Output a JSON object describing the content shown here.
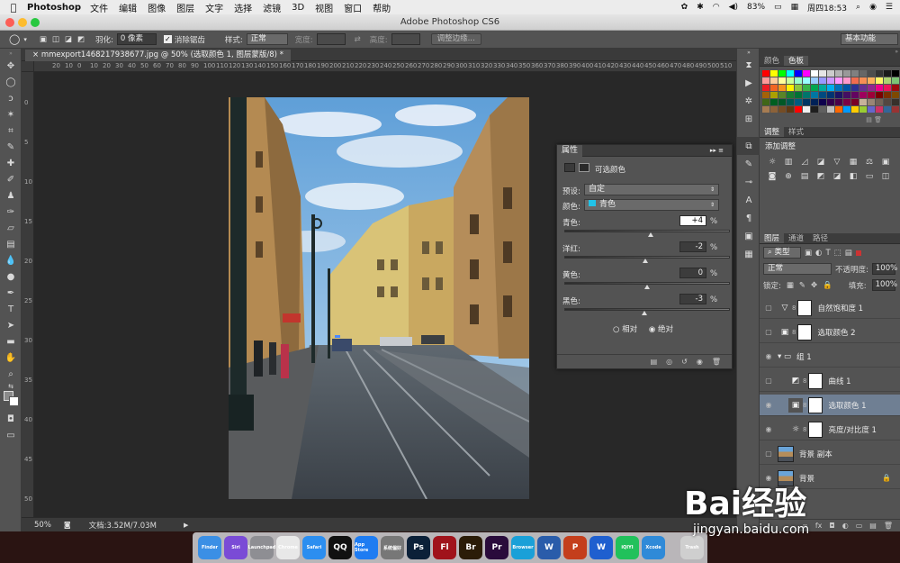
{
  "menubar": {
    "app": "Photoshop",
    "items": [
      "文件",
      "编辑",
      "图像",
      "图层",
      "文字",
      "选择",
      "滤镜",
      "3D",
      "视图",
      "窗口",
      "帮助"
    ],
    "battery": "83%",
    "clock": "周四18:53"
  },
  "window": {
    "title": "Adobe Photoshop CS6"
  },
  "options": {
    "feather_label": "羽化:",
    "feather_value": "0 像素",
    "antialias_label": "消除锯齿",
    "style_label": "样式:",
    "style_value": "正常",
    "width_label": "宽度:",
    "height_label": "高度:",
    "refine_button": "调整边缘...",
    "workspace": "基本功能"
  },
  "document": {
    "tab": "mmexport1468217938677.jpg @ 50% (选取颜色 1, 图层蒙版/8) *",
    "ruler_h": [
      "20",
      "10",
      "0",
      "10",
      "20",
      "30",
      "40",
      "50",
      "60",
      "70",
      "80",
      "90",
      "100",
      "110",
      "120",
      "130",
      "140",
      "150",
      "160",
      "170",
      "180",
      "190",
      "200",
      "210",
      "220",
      "230",
      "240",
      "250",
      "260",
      "270",
      "280",
      "290",
      "300",
      "310",
      "320",
      "330",
      "340",
      "350",
      "360",
      "370",
      "380",
      "390",
      "400",
      "410",
      "420",
      "430",
      "440",
      "450",
      "460",
      "470",
      "480",
      "490",
      "500",
      "510",
      "520",
      "530",
      "540",
      "550"
    ],
    "ruler_v": [
      "0",
      "5",
      "10",
      "15",
      "20",
      "25",
      "30",
      "35",
      "40",
      "45",
      "50"
    ],
    "zoom": "50%",
    "doc_size": "文档:3.52M/7.03M"
  },
  "properties": {
    "panel_title": "属性",
    "subtitle": "可选颜色",
    "preset_label": "预设:",
    "preset_value": "自定",
    "color_label": "颜色:",
    "color_value": "青色",
    "sliders": [
      {
        "label": "青色:",
        "value": "+4",
        "fraction": 0.52
      },
      {
        "label": "洋红:",
        "value": "-2",
        "fraction": 0.49
      },
      {
        "label": "黄色:",
        "value": "0",
        "fraction": 0.5
      },
      {
        "label": "黑色:",
        "value": "-3",
        "fraction": 0.485
      }
    ],
    "pct": "%",
    "relative": "相对",
    "absolute": "绝对"
  },
  "swatches": {
    "tabs": [
      "颜色",
      "色板"
    ],
    "colors": [
      "#ff0000",
      "#ffff00",
      "#00ff00",
      "#00ffff",
      "#0000ff",
      "#ff00ff",
      "#ffffff",
      "#e6e6e6",
      "#cccccc",
      "#b3b3b3",
      "#999999",
      "#808080",
      "#666666",
      "#4d4d4d",
      "#333333",
      "#1a1a1a",
      "#000000",
      "#ff4d4d",
      "#ff9999",
      "#ffcc99",
      "#ffff99",
      "#ccff99",
      "#99ffcc",
      "#99ffff",
      "#99ccff",
      "#9999ff",
      "#cc99ff",
      "#ff99ff",
      "#ff99cc",
      "#f26c4f",
      "#f68e55",
      "#fbaf5d",
      "#fff467",
      "#acd372",
      "#7cc576",
      "#3bb878",
      "#ed1c24",
      "#f26522",
      "#f7941d",
      "#fff200",
      "#8dc63f",
      "#39b54a",
      "#00a651",
      "#00a99d",
      "#00aeef",
      "#0072bc",
      "#0054a6",
      "#2e3192",
      "#662d91",
      "#92278f",
      "#ec008c",
      "#ed145b",
      "#9e0b0f",
      "#a0410d",
      "#a36209",
      "#aba000",
      "#598527",
      "#197b30",
      "#007236",
      "#00746b",
      "#0076a3",
      "#004a80",
      "#003471",
      "#1b1464",
      "#440e62",
      "#630460",
      "#9e005d",
      "#9e0039",
      "#790000",
      "#7b2e00",
      "#7d4900",
      "#827b00",
      "#406618",
      "#005e20",
      "#005826",
      "#005952",
      "#005b7f",
      "#003663",
      "#002157",
      "#0d004c",
      "#32004b",
      "#4b0049",
      "#7b0046",
      "#7a0026",
      "#c7b299",
      "#998675",
      "#736357",
      "#534741",
      "#37302a",
      "#c69c6d",
      "#a67c52",
      "#8c6239",
      "#754c24",
      "#603913",
      "#ff0000",
      "#f0f0f0",
      "#1e1e1e",
      "#606060",
      "#c0c0c0",
      "#ff6600",
      "#0099ff",
      "#ffcc00",
      "#99cc33",
      "#6666cc",
      "#cc3366",
      "#336699",
      "#993333",
      "#669966"
    ]
  },
  "adjustments": {
    "tabs": [
      "调整",
      "样式"
    ],
    "heading": "添加调整",
    "icons": [
      "brightness-icon",
      "levels-icon",
      "curves-icon",
      "exposure-icon",
      "vibrance-icon",
      "hsl-icon",
      "color-balance-icon",
      "bw-icon",
      "photo-filter-icon",
      "channel-mixer-icon",
      "color-lookup-icon",
      "invert-icon",
      "posterize-icon",
      "threshold-icon",
      "gradient-map-icon",
      "selective-color-icon"
    ]
  },
  "layers": {
    "tabs": [
      "图层",
      "通道",
      "路径"
    ],
    "filter": "类型",
    "blend_mode": "正常",
    "opacity_label": "不透明度:",
    "opacity_value": "100%",
    "lock_label": "锁定:",
    "fill_label": "填充:",
    "fill_value": "100%",
    "items": [
      {
        "name": "自然饱和度 1",
        "icon": "▽",
        "indent": 0,
        "selected": false,
        "visible": false
      },
      {
        "name": "选取颜色 2",
        "icon": "▣",
        "indent": 0,
        "selected": false,
        "visible": false
      },
      {
        "name": "组 1",
        "icon": "▸",
        "indent": 0,
        "selected": false,
        "visible": true
      },
      {
        "name": "曲线 1",
        "icon": "◩",
        "indent": 1,
        "selected": false,
        "visible": false
      },
      {
        "name": "选取颜色 1",
        "icon": "▣",
        "indent": 1,
        "selected": true,
        "visible": true
      },
      {
        "name": "亮度/对比度 1",
        "icon": "☼",
        "indent": 1,
        "selected": false,
        "visible": true
      },
      {
        "name": "背景 副本",
        "icon": "",
        "indent": 0,
        "selected": false,
        "visible": false
      },
      {
        "name": "背景",
        "icon": "",
        "indent": 0,
        "selected": false,
        "visible": true
      }
    ]
  },
  "dock": [
    "Finder",
    "Siri",
    "Launchpad",
    "Chrome",
    "Safari",
    "QQ",
    "App Store",
    "系统偏好",
    "Ps",
    "Fl",
    "Br",
    "Pr",
    "Browser",
    "W",
    "P",
    "W",
    "iQIYI",
    "Xcode",
    "Trash"
  ],
  "watermark": "Bai经验",
  "watermark_url": "jingyan.baidu.com"
}
